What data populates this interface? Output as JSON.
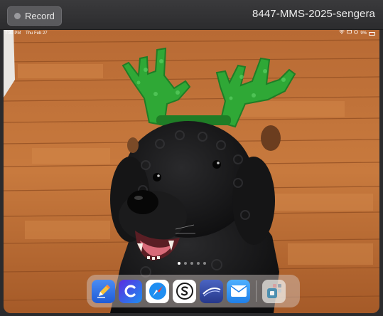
{
  "recorder": {
    "record_label": "Record",
    "session_title": "8447-MMS-2025-sengera"
  },
  "statusbar": {
    "time": "7:39 PM",
    "date": "Thu Feb 27",
    "battery": "9%"
  },
  "home": {
    "page_count": 5,
    "active_page": 1,
    "wallpaper": "black poodle wearing green reindeer antler headband on wooden floor"
  },
  "dock": {
    "apps": [
      {
        "name": "Pages",
        "icon": "pen-icon",
        "color": "#2f6fe0"
      },
      {
        "name": "Canva",
        "icon": "c-logo-icon",
        "color": "#3b3fd8"
      },
      {
        "name": "Safari",
        "icon": "compass-icon",
        "color": "#1e8cf0"
      },
      {
        "name": "Schoology",
        "icon": "s-logo-icon",
        "color": "#ffffff"
      },
      {
        "name": "Keynote",
        "icon": "swoosh-icon",
        "color": "#334aa8"
      },
      {
        "name": "Mail",
        "icon": "envelope-icon",
        "color": "#2f8ff2"
      },
      {
        "name": "App Library",
        "icon": "app-library-icon",
        "color": "#9cc4d8"
      }
    ]
  }
}
